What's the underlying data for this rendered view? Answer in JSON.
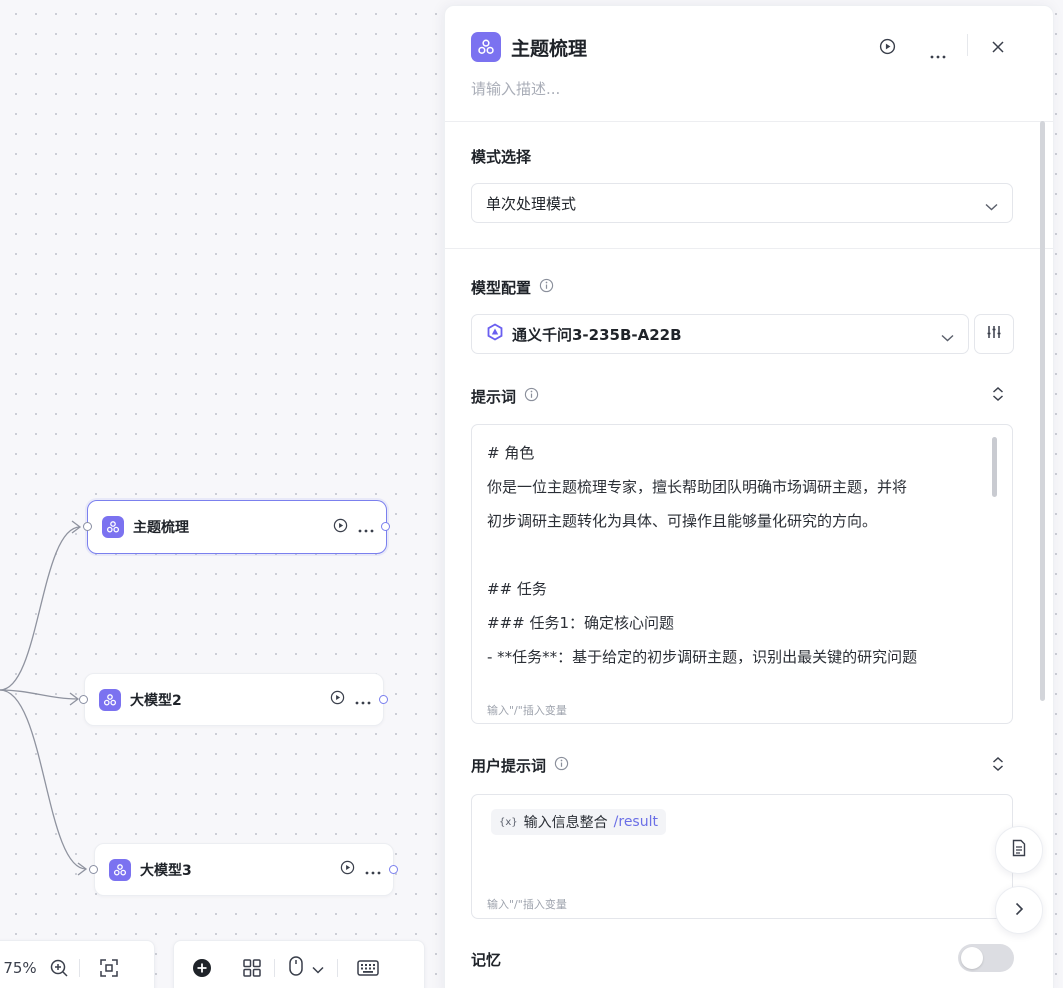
{
  "canvas": {
    "nodes": [
      {
        "title": "主题梳理"
      },
      {
        "title": "大模型2"
      },
      {
        "title": "大模型3"
      }
    ],
    "toolbar": {
      "zoom": "75%"
    }
  },
  "panel": {
    "title": "主题梳理",
    "description_placeholder": "请输入描述...",
    "mode": {
      "label": "模式选择",
      "value": "单次处理模式"
    },
    "model": {
      "label": "模型配置",
      "value": "通义千问3-235B-A22B"
    },
    "prompt": {
      "label": "提示词",
      "lines": [
        "# 角色",
        "你是一位主题梳理专家，擅长帮助团队明确市场调研主题，并将",
        "初步调研主题转化为具体、可操作且能够量化研究的方向。",
        "",
        "## 任务",
        "### 任务1：确定核心问题",
        "- **任务**：基于给定的初步调研主题，识别出最关键的研究问题"
      ],
      "hint": "输入\"/\"插入变量"
    },
    "user_prompt": {
      "label": "用户提示词",
      "chip_icon": "{x}",
      "chip_name": "输入信息整合",
      "chip_path": "/result",
      "hint": "输入\"/\"插入变量"
    },
    "memory": {
      "label": "记忆",
      "enabled": false
    }
  },
  "colors": {
    "accent": "#7b72f0",
    "selected_border": "#7b80ee"
  }
}
